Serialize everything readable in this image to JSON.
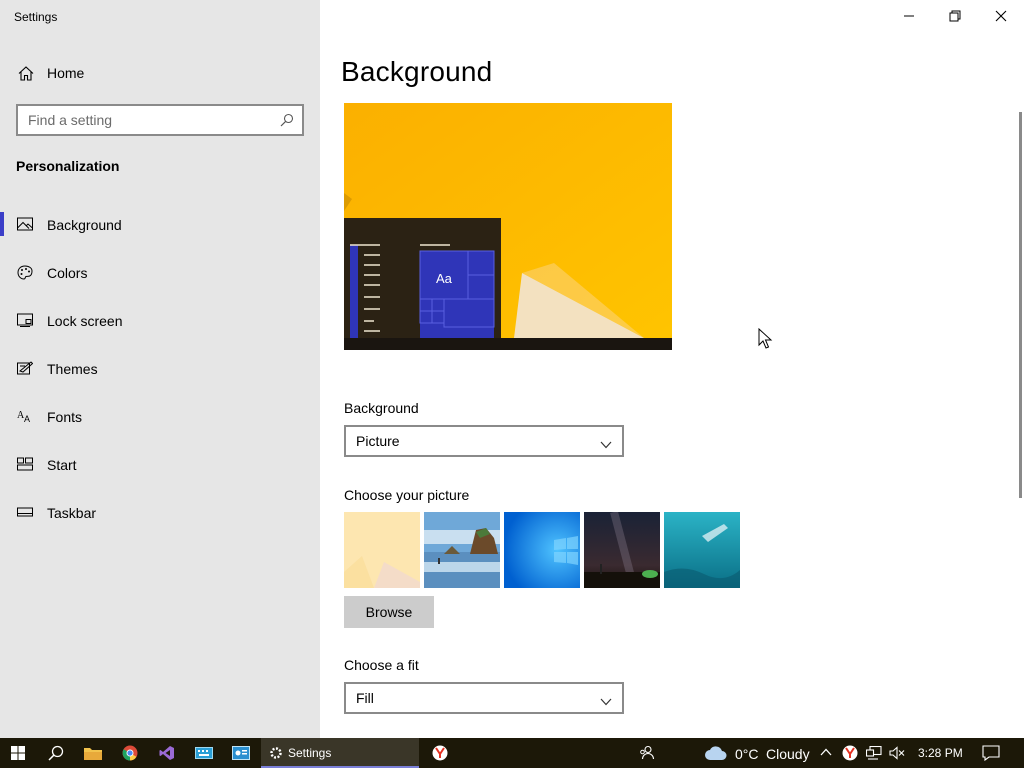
{
  "window": {
    "title": "Settings",
    "controls": {
      "minimize_icon": "minimize-icon",
      "restore_icon": "restore-icon",
      "close_icon": "close-icon"
    }
  },
  "sidebar": {
    "home_label": "Home",
    "home_icon": "home-icon",
    "search": {
      "placeholder": "Find a setting",
      "value": "",
      "icon": "search-icon"
    },
    "section_title": "Personalization",
    "items": [
      {
        "label": "Background",
        "icon": "background-icon",
        "selected": true
      },
      {
        "label": "Colors",
        "icon": "palette-icon",
        "selected": false
      },
      {
        "label": "Lock screen",
        "icon": "lock-screen-icon",
        "selected": false
      },
      {
        "label": "Themes",
        "icon": "themes-icon",
        "selected": false
      },
      {
        "label": "Fonts",
        "icon": "fonts-icon",
        "selected": false
      },
      {
        "label": "Start",
        "icon": "start-icon",
        "selected": false
      },
      {
        "label": "Taskbar",
        "icon": "taskbar-icon",
        "selected": false
      }
    ]
  },
  "main": {
    "page_title": "Background",
    "preview": {
      "tile_text": "Aa"
    },
    "background_label": "Background",
    "background_value": "Picture",
    "choose_picture_label": "Choose your picture",
    "pictures": [
      {
        "name": "yellow-abstract"
      },
      {
        "name": "beach-rock"
      },
      {
        "name": "windows-blue"
      },
      {
        "name": "night-sky"
      },
      {
        "name": "underwater-swimmer"
      }
    ],
    "browse_label": "Browse",
    "fit_label": "Choose a fit",
    "fit_value": "Fill"
  },
  "taskbar": {
    "active_app_label": "Settings",
    "weather": {
      "temperature": "0°C",
      "condition": "Cloudy"
    },
    "clock": "3:28 PM"
  },
  "colors": {
    "sidebar_bg": "#e6e6e6",
    "accent": "#3b3ec8",
    "taskbar_bg": "#1c1808",
    "preview_yellow": "#fbb800"
  }
}
